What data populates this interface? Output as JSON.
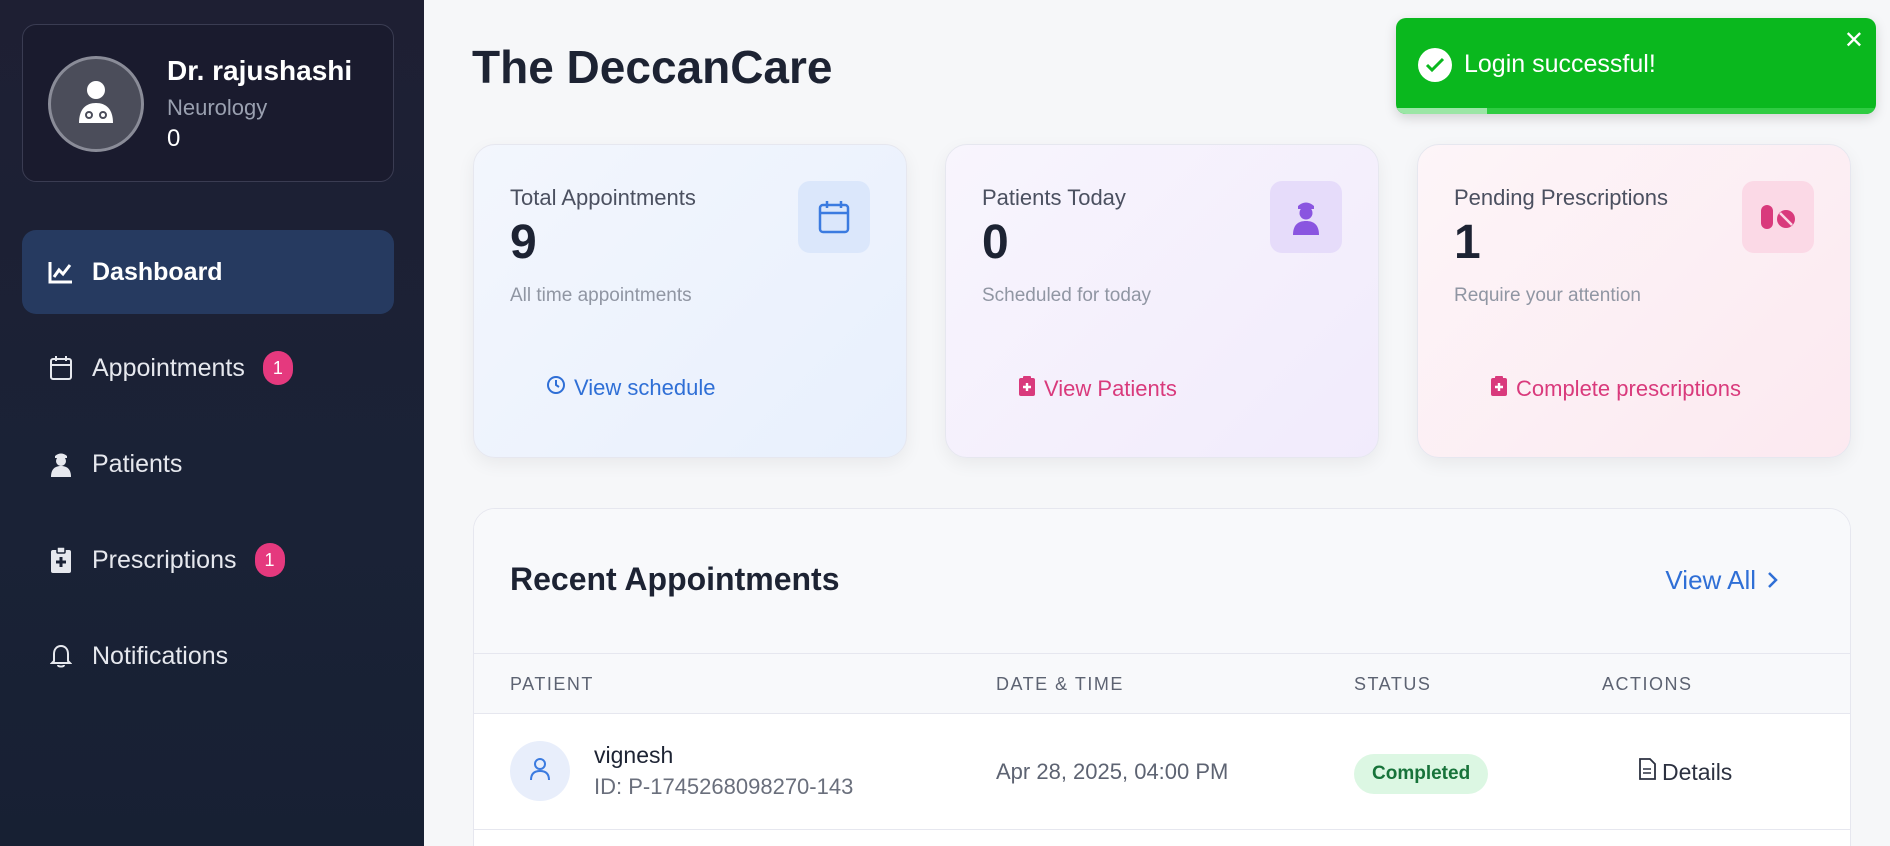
{
  "sidebar": {
    "profile": {
      "name": "Dr. rajushashi",
      "specialty": "Neurology",
      "count": "0"
    },
    "items": [
      {
        "label": "Dashboard",
        "icon": "chart-line-icon",
        "active": true
      },
      {
        "label": "Appointments",
        "icon": "calendar-icon",
        "badge": "1"
      },
      {
        "label": "Patients",
        "icon": "user-nurse-icon"
      },
      {
        "label": "Prescriptions",
        "icon": "clipboard-medical-icon",
        "badge": "1"
      },
      {
        "label": "Notifications",
        "icon": "bell-icon"
      }
    ]
  },
  "main": {
    "title": "The DeccanCare",
    "cards": [
      {
        "title": "Total Appointments",
        "value": "9",
        "sub": "All time appointments",
        "link": "View schedule",
        "icon": "calendar-icon"
      },
      {
        "title": "Patients Today",
        "value": "0",
        "sub": "Scheduled for today",
        "link": "View Patients",
        "icon": "user-nurse-icon"
      },
      {
        "title": "Pending Prescriptions",
        "value": "1",
        "sub": "Require your attention",
        "link": "Complete prescriptions",
        "icon": "pills-icon"
      }
    ],
    "recent": {
      "title": "Recent Appointments",
      "view_all": "View All",
      "columns": [
        "PATIENT",
        "DATE & TIME",
        "STATUS",
        "ACTIONS"
      ],
      "rows": [
        {
          "name": "vignesh",
          "id": "ID: P-1745268098270-143",
          "datetime": "Apr 28, 2025, 04:00 PM",
          "status": "Completed",
          "action": "Details"
        }
      ]
    }
  },
  "toast": {
    "message": "Login successful!",
    "progress": 0.19
  },
  "colors": {
    "accent_blue": "#2f6fd6",
    "accent_pink": "#d93a7c",
    "success": "#0ab81e",
    "sidebar": "#1a2236"
  }
}
